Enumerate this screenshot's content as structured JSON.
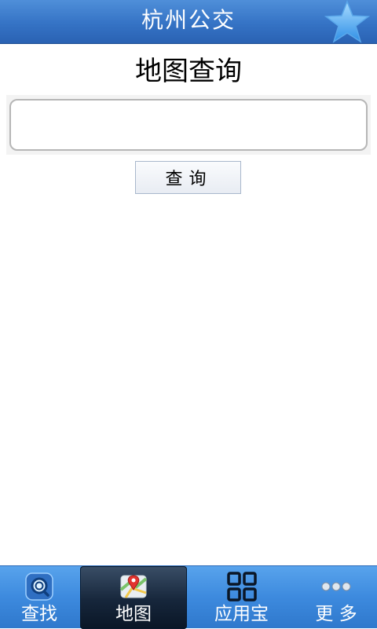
{
  "header": {
    "title": "杭州公交",
    "favorite_icon": "star-icon",
    "accent": "#3573c5"
  },
  "main": {
    "title": "地图查询",
    "search_input": {
      "value": "",
      "placeholder": ""
    },
    "search_button_label": "查询"
  },
  "tabbar": {
    "tabs": [
      {
        "label": "查找",
        "icon": "search-icon",
        "active": false
      },
      {
        "label": "地图",
        "icon": "map-icon",
        "active": true
      },
      {
        "label": "应用宝",
        "icon": "grid-icon",
        "active": false
      },
      {
        "label": "更 多",
        "icon": "more-icon",
        "active": false
      }
    ]
  }
}
